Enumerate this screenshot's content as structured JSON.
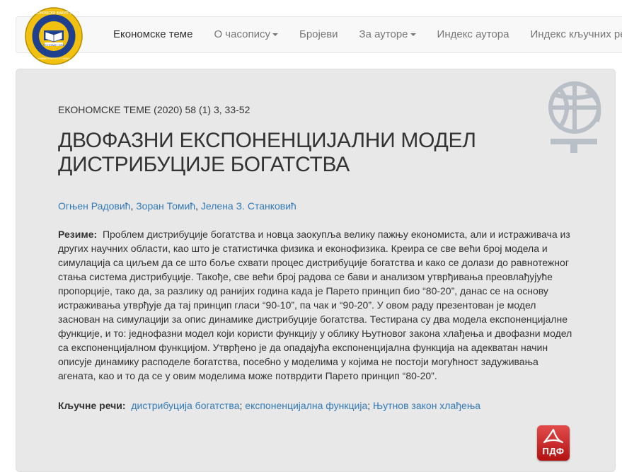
{
  "navbar": {
    "items": [
      {
        "label": "Економске теме",
        "active": true,
        "dropdown": false
      },
      {
        "label": "О часопису",
        "active": false,
        "dropdown": true
      },
      {
        "label": "Бројеви",
        "active": false,
        "dropdown": false
      },
      {
        "label": "За ауторе",
        "active": false,
        "dropdown": true
      },
      {
        "label": "Индекс аутора",
        "active": false,
        "dropdown": false
      },
      {
        "label": "Индекс кључних речи",
        "active": false,
        "dropdown": false
      }
    ]
  },
  "logo": {
    "icon": "university-seal-logo",
    "text_top": "ЕКОНОМСКИ ФАКУЛТЕТ",
    "text_mid": "ОСНОВАН 1960",
    "text_bottom": "УНИВЕРЗИТЕТ У НИШУ"
  },
  "article": {
    "citation": "ЕКОНОМСКЕ ТЕМЕ (2020) 58 (1) 3, 33-52",
    "title": "ДВОФАЗНИ ЕКСПОНЕНЦИЈАЛНИ МОДЕЛ ДИСТРИБУЦИЈЕ БОГАТСТВА",
    "authors": [
      "Огњен Радовић",
      "Зоран Томић",
      "Јелена З. Станковић"
    ],
    "abstract_label": "Резиме:",
    "abstract": "Проблем дистрибуције богатства и новца заокупља велику пажњу економиста, али и истраживача из других научних области, као што је статистичка физика и еконофизика. Креира се све већи број модела и симулација са циљем да се што боље схвати процес дистрибуције богатства и како се долази до равнотежног стања система дистрибуције. Такође, све већи број радова се бави и анализом утврђивања преовлађујуће пропорције, тако да, за разлику од ранијих година када је Парето принцип био “80-20”, данас се на основу истраживања утврђује да тај принцип гласи “90-10”, па чак и “90-20”. У овом раду презентован је модел заснован на симулацији за опис динамике дистрибуције богатства. Тестирана су два модела експоненцијалне функције, и то: једнофазни модел који користи функцију у облику Њутновог закона хлађења и двофазни модел са експоненцијалном функцијом. Утврђено је да опадајућа експоненцијална функција на адекватан начин описује динамику расподеле богатства, посебно у моделима у којима не постоји могућност задуживања агената, као и то да се у овим моделима може потврдити Парето принцип “80-20”.",
    "keywords_label": "Кључне речи:",
    "keywords": [
      "дистрибуција богатства",
      "експоненцијална функција",
      "Њутнов закон хлађења"
    ]
  },
  "pdf": {
    "label": "ПДФ",
    "icon": "pdf-icon"
  },
  "decor": {
    "icon": "journal-globe-icon"
  },
  "colors": {
    "link": "#337ab7",
    "panel": "#e8e8e8",
    "navbar": "#f8f8f8",
    "pdf": "#c9201f"
  }
}
